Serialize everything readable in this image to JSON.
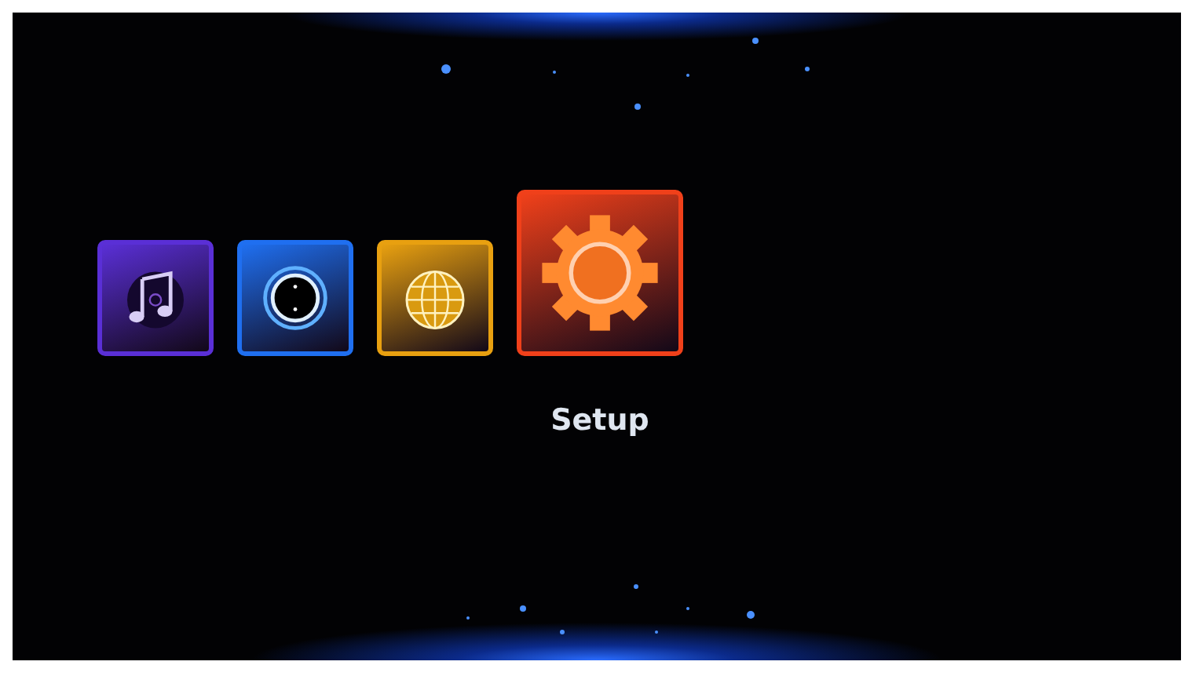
{
  "menu": {
    "items": [
      {
        "kind": "music",
        "selected": false,
        "color": "#5a2fd6"
      },
      {
        "kind": "video",
        "selected": false,
        "color": "#1f6ff0"
      },
      {
        "kind": "internet",
        "selected": false,
        "color": "#e8a010"
      },
      {
        "kind": "setup",
        "selected": true,
        "color": "#f0401a",
        "label": "Setup"
      }
    ]
  }
}
